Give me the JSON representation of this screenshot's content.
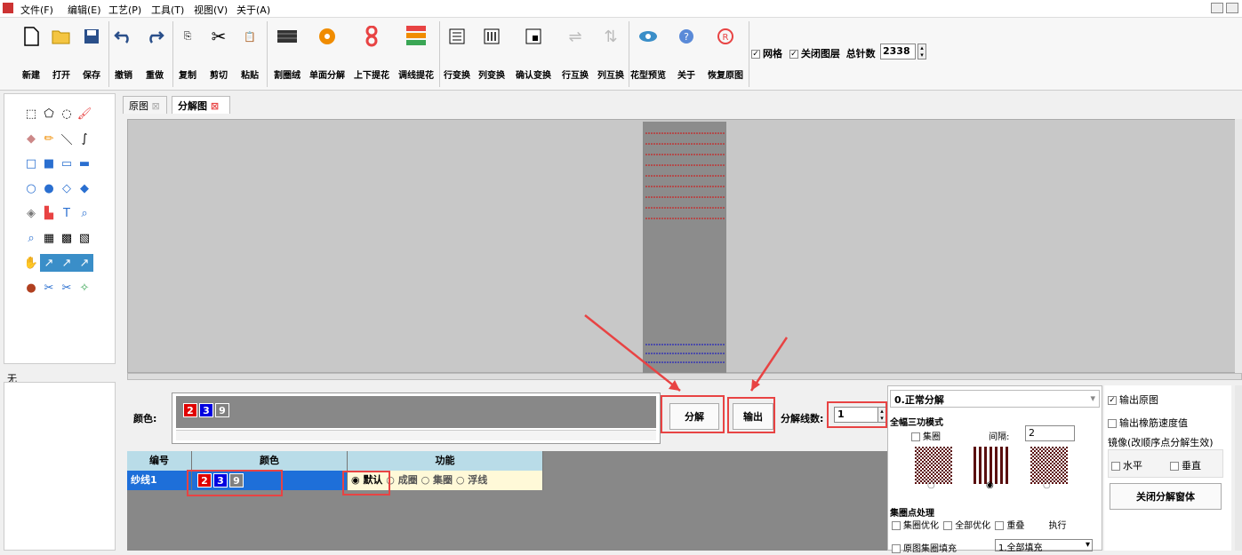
{
  "menu": [
    "文件(F)",
    "编辑(E)",
    "工艺(P)",
    "工具(T)",
    "视图(V)",
    "关于(A)"
  ],
  "toolbar": {
    "items": [
      "新建",
      "打开",
      "保存",
      "撤销",
      "重做",
      "复制",
      "剪切",
      "粘贴",
      "割圈绒",
      "单面分解",
      "上下提花",
      "调线提花",
      "行变换",
      "列变换",
      "确认变换",
      "行互换",
      "列互换",
      "花型预览",
      "关于",
      "恢复原图"
    ],
    "grid_label": "网格",
    "close_layer_label": "关闭图层",
    "total_needles_label": "总针数",
    "total_needles_value": "2338"
  },
  "tabs": [
    "原图",
    "分解图"
  ],
  "left_status": "无",
  "colors": {
    "label": "颜色:",
    "chips": [
      "2",
      "3",
      "9"
    ]
  },
  "actions": {
    "decompose": "分解",
    "output": "输出",
    "lines_label": "分解线数:",
    "lines_value": "1"
  },
  "table": {
    "headers": [
      "编号",
      "颜色",
      "功能"
    ],
    "row": {
      "id": "纱线1",
      "chips": [
        "2",
        "3",
        "9"
      ],
      "functions": [
        "默认",
        "成圈",
        "集圈",
        "浮线"
      ]
    }
  },
  "right_panel": {
    "mode": "0.正常分解",
    "section1": "全幅三功模式",
    "tuck_label": "集圈",
    "interval_label": "间隔:",
    "interval_value": "2",
    "section2": "集圈点处理",
    "opt1": "集圈优化",
    "opt2": "全部优化",
    "opt3": "重叠",
    "execute": "执行",
    "fill_label": "原图集圈填充",
    "fill_value": "1.全部填充"
  },
  "far_right": {
    "output_original": "输出原图",
    "output_speed": "输出橡筋速度值",
    "mirror_label": "镜像(改顺序点分解生效)",
    "horizontal": "水平",
    "vertical": "垂直",
    "close_window": "关闭分解窗体"
  },
  "colors_hex": {
    "red": "#e00000",
    "blue": "#0000e0",
    "gray": "#808080",
    "accent": "#e84343"
  }
}
